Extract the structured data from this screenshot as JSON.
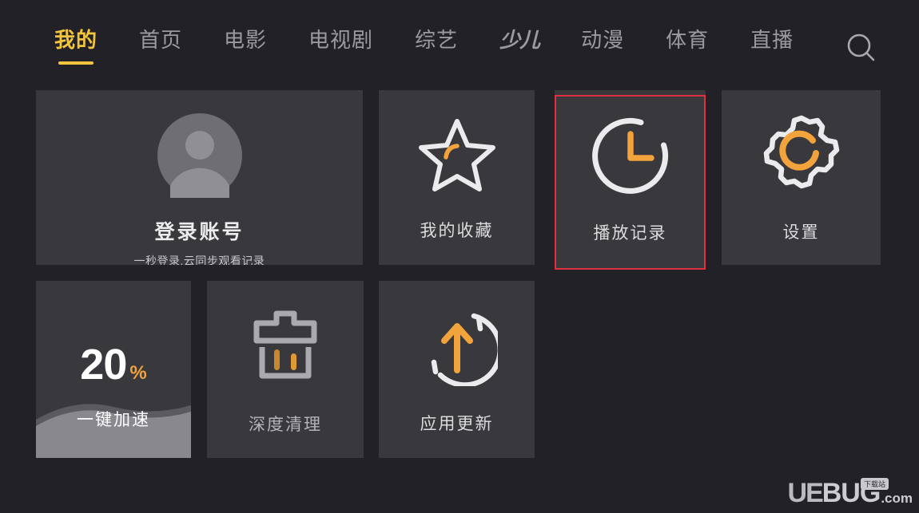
{
  "theme": {
    "page_background": "#212127",
    "card_background": "#38383d",
    "accent_orange": "#F2A33C",
    "accent_yellow": "#F2C53D",
    "highlight_border": "#e03040",
    "text_primary": "#ececef",
    "text_secondary": "#9a9aa0"
  },
  "navbar": {
    "tabs": [
      {
        "label": "我的",
        "name": "tab-mine",
        "active": true
      },
      {
        "label": "首页",
        "name": "tab-home",
        "active": false
      },
      {
        "label": "电影",
        "name": "tab-movies",
        "active": false
      },
      {
        "label": "电视剧",
        "name": "tab-tv",
        "active": false
      },
      {
        "label": "综艺",
        "name": "tab-variety",
        "active": false
      },
      {
        "label": "少儿",
        "name": "tab-kids",
        "active": false
      },
      {
        "label": "动漫",
        "name": "tab-anime",
        "active": false
      },
      {
        "label": "体育",
        "name": "tab-sports",
        "active": false
      },
      {
        "label": "直播",
        "name": "tab-live",
        "active": false
      }
    ],
    "search_icon": "search-icon"
  },
  "cards": {
    "login": {
      "icon": "user-avatar-icon",
      "title": "登录账号",
      "subtitle": "一秒登录,云同步观看记录"
    },
    "favorites": {
      "icon": "star-icon",
      "label": "我的收藏"
    },
    "history": {
      "icon": "clock-icon",
      "label": "播放记录",
      "focused": true
    },
    "settings": {
      "icon": "gear-icon",
      "label": "设置"
    },
    "speedup": {
      "icon": "memory-wave-icon",
      "value": "20",
      "unit": "%",
      "label": "一键加速",
      "percent": 20
    },
    "clean": {
      "icon": "broom-icon",
      "label": "深度清理"
    },
    "update": {
      "icon": "refresh-arrow-up-icon",
      "label": "应用更新"
    }
  },
  "watermark": {
    "ue": "UE",
    "bug": "BUG",
    "com": ".com",
    "badge": "下载站"
  }
}
